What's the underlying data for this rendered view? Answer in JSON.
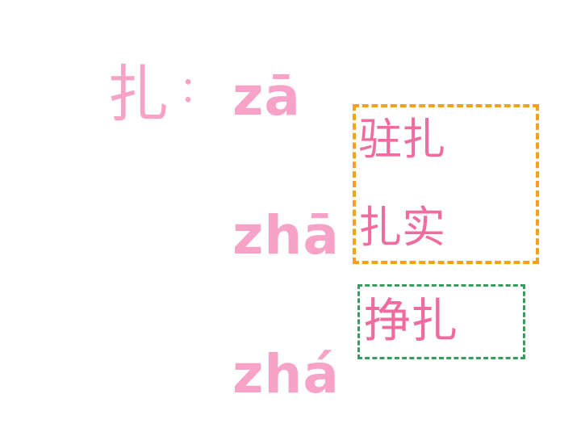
{
  "character": "扎",
  "separator": "：",
  "readings": [
    {
      "pinyin": "zā"
    },
    {
      "pinyin": "zhā"
    },
    {
      "pinyin": "zhá"
    }
  ],
  "word_groups": [
    {
      "color": "#f5a21b",
      "words": [
        "驻扎",
        "扎实"
      ]
    },
    {
      "color": "#3a9a5f",
      "words": [
        "挣扎"
      ]
    }
  ],
  "colors": {
    "pinyin_text": "#f7a3c8",
    "word_text": "#f06b9f",
    "background": "#ffffff"
  }
}
